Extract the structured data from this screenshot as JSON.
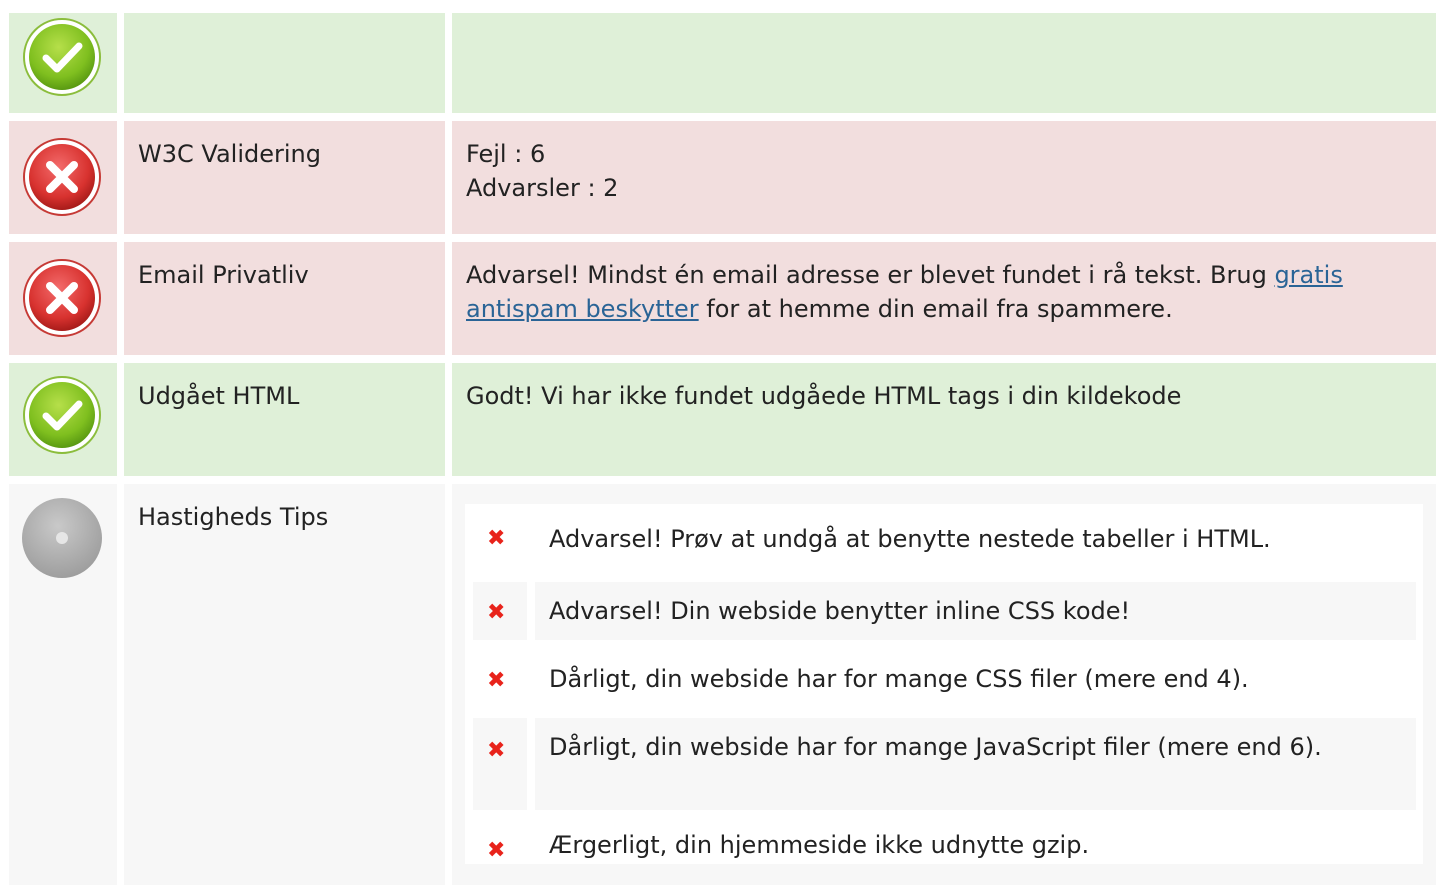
{
  "rows": [
    {
      "status": "pass",
      "label": "",
      "content": ""
    },
    {
      "status": "fail",
      "label": "W3C Validering",
      "lines": [
        "Fejl : 6",
        "Advarsler : 2"
      ]
    },
    {
      "status": "fail",
      "label": "Email Privatliv",
      "text_before": "Advarsel! Mindst én email adresse er blevet fundet i rå tekst. Brug ",
      "link_text": "gratis antispam beskytter",
      "text_after": " for at hemme din email fra spammere."
    },
    {
      "status": "pass",
      "label": "Udgået HTML",
      "content": "Godt! Vi har ikke fundet udgåede HTML tags i din kildekode"
    },
    {
      "status": "neutral",
      "label": "Hastigheds Tips",
      "tips": [
        "Advarsel! Prøv at undgå at benytte nestede tabeller i HTML.",
        "Advarsel! Din webside benytter inline CSS kode!",
        "Dårligt, din webside har for mange CSS filer (mere end 4).",
        "Dårligt, din webside har for mange JavaScript filer (mere end 6).",
        "Ærgerligt, din hjemmeside ikke udnytte gzip."
      ]
    }
  ],
  "icons": {
    "pass": "check-circle-icon",
    "fail": "x-circle-icon",
    "neutral": "gray-dot-icon",
    "tip": "red-x-mark"
  },
  "colors": {
    "pass_bg": "#dff0d8",
    "fail_bg": "#f2dede",
    "neutral_bg": "#f7f7f7",
    "link": "#2a6496",
    "tip_x": "#e8231b"
  }
}
